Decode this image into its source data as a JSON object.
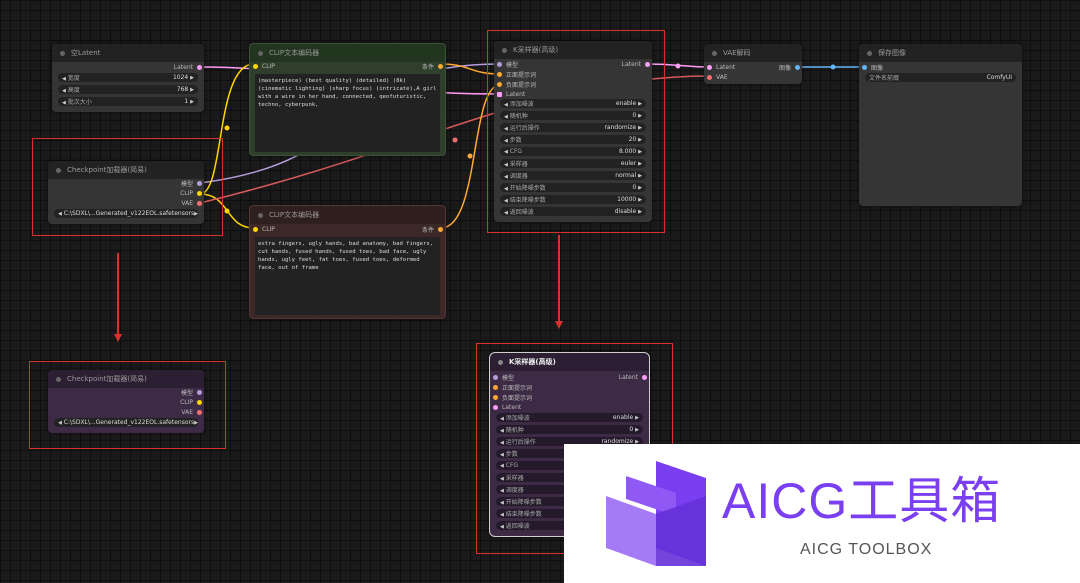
{
  "empty_latent": {
    "title": "空Latent",
    "output": "Latent",
    "widgets": [
      {
        "label": "宽度",
        "value": "1024"
      },
      {
        "label": "高度",
        "value": "768"
      },
      {
        "label": "批次大小",
        "value": "1"
      }
    ]
  },
  "checkpoint": {
    "title": "Checkpoint加载器(简易)",
    "outputs": [
      "模型",
      "CLIP",
      "VAE"
    ],
    "ckpt": "C:\\SDXL\\...Generated_v122EOL.safetensors"
  },
  "checkpoint_collapsed": {
    "title": "Checkpoint加载器(简易)",
    "outputs": [
      "模型",
      "CLIP",
      "VAE"
    ],
    "ckpt": "C:\\SDXL\\...Generated_v122EOL.safetensors"
  },
  "clip_positive": {
    "title": "CLIP文本编码器",
    "input": "CLIP",
    "output": "条件",
    "text": "(masterpiece) (best quality) (detailed) (8k) (cinematic lighting) (sharp focus) (intricate),A girl with a wire in her hand, connected, qeofuturistic, techno, cyberpunk,"
  },
  "clip_negative": {
    "title": "CLIP文本编码器",
    "input": "CLIP",
    "output": "条件",
    "text": "extra fingers, ugly hands, bad anatomy, bad fingers, cut hands, fused hands, fused toes, bad face, ugly hands, ugly feet, fat toes, fused toes, deformed face, out of frame"
  },
  "ksampler": {
    "title": "K采样器(高级)",
    "inputs": [
      "模型",
      "正面提示词",
      "负面提示词",
      "Latent"
    ],
    "output": "Latent",
    "widgets": [
      {
        "label": "添加噪波",
        "value": "enable"
      },
      {
        "label": "随机种",
        "value": "0"
      },
      {
        "label": "运行后操作",
        "value": "randomize"
      },
      {
        "label": "步数",
        "value": "20"
      },
      {
        "label": "CFG",
        "value": "8.000"
      },
      {
        "label": "采样器",
        "value": "euler"
      },
      {
        "label": "调度器",
        "value": "normal"
      },
      {
        "label": "开始降噪步数",
        "value": "0"
      },
      {
        "label": "结束降噪步数",
        "value": "10000"
      },
      {
        "label": "返回噪波",
        "value": "disable"
      }
    ]
  },
  "ksampler_purple": {
    "title": "K采样器(高级)",
    "inputs": [
      "模型",
      "正面提示词",
      "负面提示词",
      "Latent"
    ],
    "output": "Latent",
    "widgets": [
      {
        "label": "添加噪波",
        "value": "enable"
      },
      {
        "label": "随机种",
        "value": "0"
      },
      {
        "label": "运行后操作",
        "value": "randomize"
      },
      {
        "label": "步数",
        "value": ""
      },
      {
        "label": "CFG",
        "value": ""
      },
      {
        "label": "采样器",
        "value": ""
      },
      {
        "label": "调度器",
        "value": ""
      },
      {
        "label": "开始降噪步数",
        "value": ""
      },
      {
        "label": "结束降噪步数",
        "value": ""
      },
      {
        "label": "返回噪波",
        "value": ""
      }
    ]
  },
  "vae_decode": {
    "title": "VAE解码",
    "inputs": [
      "Latent",
      "VAE"
    ],
    "output": "图像"
  },
  "save_image": {
    "title": "保存图像",
    "input": "图像",
    "widget": {
      "label": "文件名前缀",
      "value": "ComfyUI"
    }
  },
  "watermark": {
    "title": "AICG工具箱",
    "subtitle": "AICG TOOLBOX"
  },
  "colors": {
    "latent": "#ff9cf9",
    "clip": "#ffd500",
    "vae": "#ff6e6e",
    "conditioning": "#ffa931",
    "model": "#b39ddb",
    "image": "#64b5f6",
    "highlight": "#d6312c",
    "brand": "#7b3ff2"
  }
}
